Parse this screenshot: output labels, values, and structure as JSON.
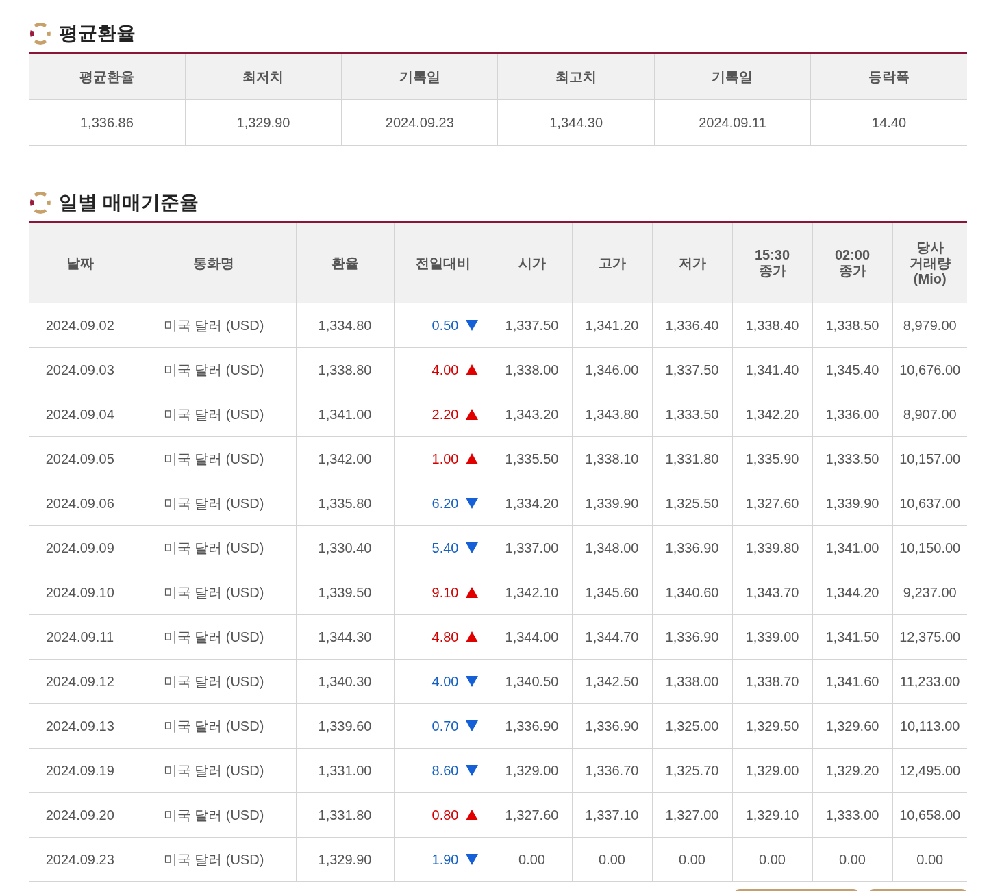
{
  "average_section": {
    "title": "평균환율",
    "columns": [
      "평균환율",
      "최저치",
      "기록일",
      "최고치",
      "기록일",
      "등락폭"
    ],
    "row": [
      "1,336.86",
      "1,329.90",
      "2024.09.23",
      "1,344.30",
      "2024.09.11",
      "14.40"
    ]
  },
  "daily_section": {
    "title": "일별 매매기준율",
    "columns": [
      [
        "날짜"
      ],
      [
        "통화명"
      ],
      [
        "환율"
      ],
      [
        "전일대비"
      ],
      [
        "시가"
      ],
      [
        "고가"
      ],
      [
        "저가"
      ],
      [
        "15:30",
        "종가"
      ],
      [
        "02:00",
        "종가"
      ],
      [
        "당사",
        "거래량",
        "(Mio)"
      ]
    ],
    "rows": [
      {
        "date": "2024.09.02",
        "currency": "미국 달러 (USD)",
        "rate": "1,334.80",
        "change": "0.50",
        "rising": false,
        "open": "1,337.50",
        "high": "1,341.20",
        "low": "1,336.40",
        "close_1530": "1,338.40",
        "close_0200": "1,338.50",
        "volume": "8,979.00"
      },
      {
        "date": "2024.09.03",
        "currency": "미국 달러 (USD)",
        "rate": "1,338.80",
        "change": "4.00",
        "rising": true,
        "open": "1,338.00",
        "high": "1,346.00",
        "low": "1,337.50",
        "close_1530": "1,341.40",
        "close_0200": "1,345.40",
        "volume": "10,676.00"
      },
      {
        "date": "2024.09.04",
        "currency": "미국 달러 (USD)",
        "rate": "1,341.00",
        "change": "2.20",
        "rising": true,
        "open": "1,343.20",
        "high": "1,343.80",
        "low": "1,333.50",
        "close_1530": "1,342.20",
        "close_0200": "1,336.00",
        "volume": "8,907.00"
      },
      {
        "date": "2024.09.05",
        "currency": "미국 달러 (USD)",
        "rate": "1,342.00",
        "change": "1.00",
        "rising": true,
        "open": "1,335.50",
        "high": "1,338.10",
        "low": "1,331.80",
        "close_1530": "1,335.90",
        "close_0200": "1,333.50",
        "volume": "10,157.00"
      },
      {
        "date": "2024.09.06",
        "currency": "미국 달러 (USD)",
        "rate": "1,335.80",
        "change": "6.20",
        "rising": false,
        "open": "1,334.20",
        "high": "1,339.90",
        "low": "1,325.50",
        "close_1530": "1,327.60",
        "close_0200": "1,339.90",
        "volume": "10,637.00"
      },
      {
        "date": "2024.09.09",
        "currency": "미국 달러 (USD)",
        "rate": "1,330.40",
        "change": "5.40",
        "rising": false,
        "open": "1,337.00",
        "high": "1,348.00",
        "low": "1,336.90",
        "close_1530": "1,339.80",
        "close_0200": "1,341.00",
        "volume": "10,150.00"
      },
      {
        "date": "2024.09.10",
        "currency": "미국 달러 (USD)",
        "rate": "1,339.50",
        "change": "9.10",
        "rising": true,
        "open": "1,342.10",
        "high": "1,345.60",
        "low": "1,340.60",
        "close_1530": "1,343.70",
        "close_0200": "1,344.20",
        "volume": "9,237.00"
      },
      {
        "date": "2024.09.11",
        "currency": "미국 달러 (USD)",
        "rate": "1,344.30",
        "change": "4.80",
        "rising": true,
        "open": "1,344.00",
        "high": "1,344.70",
        "low": "1,336.90",
        "close_1530": "1,339.00",
        "close_0200": "1,341.50",
        "volume": "12,375.00"
      },
      {
        "date": "2024.09.12",
        "currency": "미국 달러 (USD)",
        "rate": "1,340.30",
        "change": "4.00",
        "rising": false,
        "open": "1,340.50",
        "high": "1,342.50",
        "low": "1,338.00",
        "close_1530": "1,338.70",
        "close_0200": "1,341.60",
        "volume": "11,233.00"
      },
      {
        "date": "2024.09.13",
        "currency": "미국 달러 (USD)",
        "rate": "1,339.60",
        "change": "0.70",
        "rising": false,
        "open": "1,336.90",
        "high": "1,336.90",
        "low": "1,325.00",
        "close_1530": "1,329.50",
        "close_0200": "1,329.60",
        "volume": "10,113.00"
      },
      {
        "date": "2024.09.19",
        "currency": "미국 달러 (USD)",
        "rate": "1,331.00",
        "change": "8.60",
        "rising": false,
        "open": "1,329.00",
        "high": "1,336.70",
        "low": "1,325.70",
        "close_1530": "1,329.00",
        "close_0200": "1,329.20",
        "volume": "12,495.00"
      },
      {
        "date": "2024.09.20",
        "currency": "미국 달러 (USD)",
        "rate": "1,331.80",
        "change": "0.80",
        "rising": true,
        "open": "1,327.60",
        "high": "1,337.10",
        "low": "1,327.00",
        "close_1530": "1,329.10",
        "close_0200": "1,333.00",
        "volume": "10,658.00"
      },
      {
        "date": "2024.09.23",
        "currency": "미국 달러 (USD)",
        "rate": "1,329.90",
        "change": "1.90",
        "rising": false,
        "open": "0.00",
        "high": "0.00",
        "low": "0.00",
        "close_1530": "0.00",
        "close_0200": "0.00",
        "volume": "0.00"
      }
    ]
  }
}
